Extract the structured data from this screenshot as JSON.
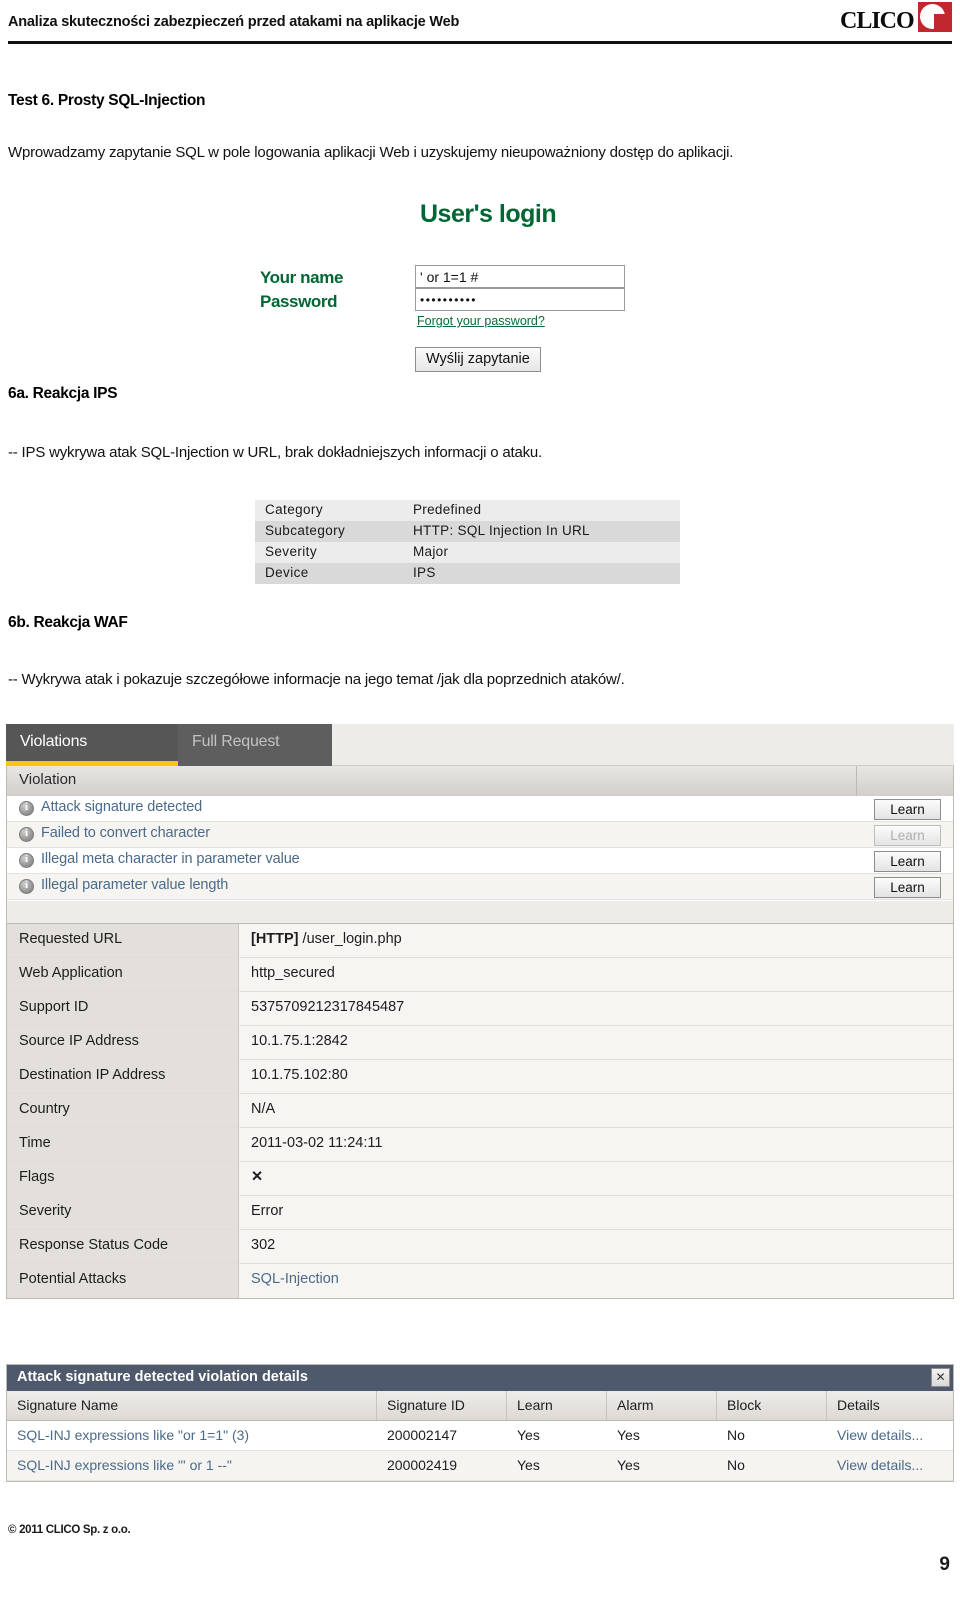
{
  "header": {
    "title": "Analiza skuteczności zabezpieczeń przed atakami na aplikacje Web",
    "logo_text": "CLICO",
    "logo_color": "#c1282d"
  },
  "sections": {
    "test6_heading": "Test 6. Prosty SQL-Injection",
    "test6_intro": "Wprowadzamy zapytanie SQL w pole logowania aplikacji Web i uzyskujemy nieupoważniony dostęp do aplikacji.",
    "heading_6a": "6a. Reakcja IPS",
    "para_6a": "-- IPS wykrywa atak SQL-Injection w URL, brak dokładniejszych informacji o ataku.",
    "heading_6b": "6b. Reakcja WAF",
    "para_6b": "-- Wykrywa atak i pokazuje szczegółowe informacje na jego temat /jak dla poprzednich ataków/."
  },
  "login_form": {
    "title": "User's login",
    "title_color": "#006633",
    "name_label": "Your name",
    "password_label": "Password",
    "name_value": "' or 1=1 #",
    "password_value": "••••••••••",
    "forgot_link": "Forgot your password?",
    "submit_label": "Wyślij zapytanie"
  },
  "ips_event": {
    "rows": [
      {
        "key": "Category",
        "value": "Predefined"
      },
      {
        "key": "Subcategory",
        "value": "HTTP: SQL Injection In URL"
      },
      {
        "key": "Severity",
        "value": "Major"
      },
      {
        "key": "Device",
        "value": "IPS"
      }
    ]
  },
  "waf": {
    "tabs": [
      {
        "label": "Violations",
        "active": true
      },
      {
        "label": "Full Request",
        "active": false
      }
    ],
    "accent_color": "#f5c518",
    "violation_column_header": "Violation",
    "violations": [
      {
        "label": "Attack signature detected",
        "button": "Learn",
        "disabled": false
      },
      {
        "label": "Failed to convert character",
        "button": "Learn",
        "disabled": true
      },
      {
        "label": "Illegal meta character in parameter value",
        "button": "Learn",
        "disabled": false
      },
      {
        "label": "Illegal parameter value length",
        "button": "Learn",
        "disabled": false
      }
    ],
    "details": [
      {
        "key": "Requested URL",
        "value_bold": "[HTTP]",
        "value": " /user_login.php",
        "link": false
      },
      {
        "key": "Web Application",
        "value": "http_secured",
        "link": false
      },
      {
        "key": "Support ID",
        "value": "5375709212317845487",
        "link": false
      },
      {
        "key": "Source IP Address",
        "value": "10.1.75.1:2842",
        "link": false
      },
      {
        "key": "Destination IP Address",
        "value": "10.1.75.102:80",
        "link": false
      },
      {
        "key": "Country",
        "value": "N/A",
        "link": false
      },
      {
        "key": "Time",
        "value": "2011-03-02 11:24:11",
        "link": false
      },
      {
        "key": "Flags",
        "value": "✕",
        "link": false,
        "is_flag": true
      },
      {
        "key": "Severity",
        "value": "Error",
        "link": false
      },
      {
        "key": "Response Status Code",
        "value": "302",
        "link": false
      },
      {
        "key": "Potential Attacks",
        "value": "SQL-Injection",
        "link": true
      }
    ],
    "signature_panel": {
      "title": "Attack signature detected violation details",
      "close_label": "✕",
      "columns": [
        "Signature Name",
        "Signature ID",
        "Learn",
        "Alarm",
        "Block",
        "Details"
      ],
      "rows": [
        {
          "name": "SQL-INJ expressions like \"or 1=1\" (3)",
          "id": "200002147",
          "learn": "Yes",
          "alarm": "Yes",
          "block": "No",
          "details": "View details..."
        },
        {
          "name": "SQL-INJ expressions like \"' or 1 --\"",
          "id": "200002419",
          "learn": "Yes",
          "alarm": "Yes",
          "block": "No",
          "details": "View details..."
        }
      ]
    }
  },
  "footer": {
    "copyright": "© 2011 CLICO Sp. z o.o.",
    "page_number": "9"
  }
}
